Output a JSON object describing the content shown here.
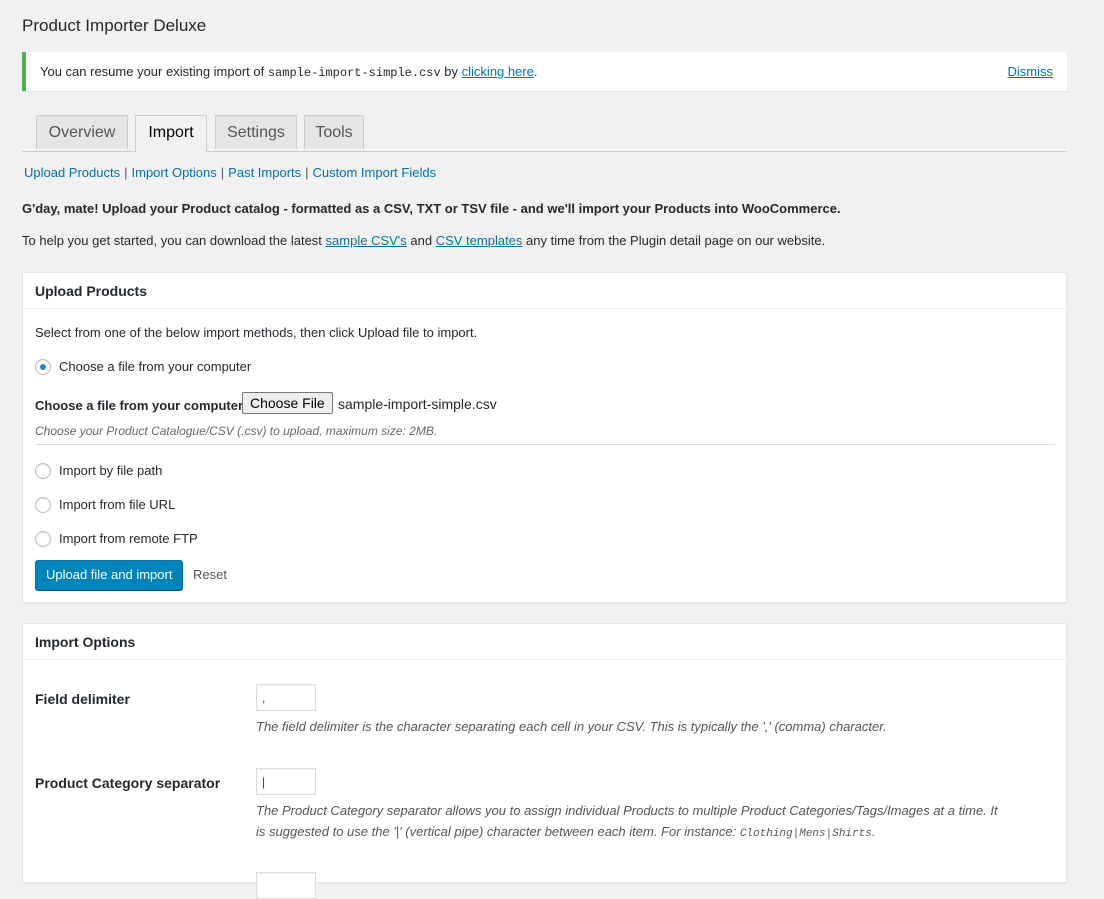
{
  "page": {
    "title": "Product Importer Deluxe"
  },
  "notice": {
    "text_before": "You can resume your existing import of ",
    "file": "sample-import-simple.csv",
    "text_mid": " by ",
    "link": "clicking here",
    "text_after": ".",
    "dismiss": "Dismiss"
  },
  "tabs": [
    {
      "label": "Overview",
      "active": false
    },
    {
      "label": "Import",
      "active": true
    },
    {
      "label": "Settings",
      "active": false
    },
    {
      "label": "Tools",
      "active": false
    }
  ],
  "subnav": {
    "items": [
      "Upload Products",
      "Import Options",
      "Past Imports",
      "Custom Import Fields"
    ],
    "separator": "|"
  },
  "intro": {
    "headline": "G'day, mate! Upload your Product catalog - formatted as a CSV, TXT or TSV file - and we'll import your Products into WooCommerce.",
    "line2_before": "To help you get started, you can download the latest ",
    "link1": "sample CSV's",
    "line2_mid": " and ",
    "link2": "CSV templates",
    "line2_after": " any time from the Plugin detail page on our website."
  },
  "upload": {
    "title": "Upload Products",
    "instruction": "Select from one of the below import methods, then click Upload file to import.",
    "method_computer": "Choose a file from your computer",
    "file_label": "Choose a file from your computer:",
    "choose_button": "Choose File",
    "chosen_file": "sample-import-simple.csv",
    "file_hint": "Choose your Product Catalogue/CSV (.csv) to upload, maximum size: 2MB.",
    "method_path": "Import by file path",
    "method_url": "Import from file URL",
    "method_ftp": "Import from remote FTP",
    "selected_method": "computer",
    "submit": "Upload file and import",
    "reset": "Reset"
  },
  "options": {
    "title": "Import Options",
    "delimiter_label": "Field delimiter",
    "delimiter_value": ",",
    "delimiter_desc": "The field delimiter is the character separating each cell in your CSV. This is typically the ',' (comma) character.",
    "category_label": "Product Category separator",
    "category_value": "|",
    "category_desc1": "The Product Category separator allows you to assign individual Products to multiple Product Categories/Tags/Images at a time. It",
    "category_desc2_before": "is suggested to use the '|' (vertical pipe) character between each item. For instance: ",
    "category_example": "Clothing|Mens|Shirts",
    "category_desc2_after": "."
  },
  "colors": {
    "notice_border": "#46b450",
    "link": "#0073aa",
    "primary_button": "#0085ba",
    "radio_dot": "#1e8cbe"
  }
}
